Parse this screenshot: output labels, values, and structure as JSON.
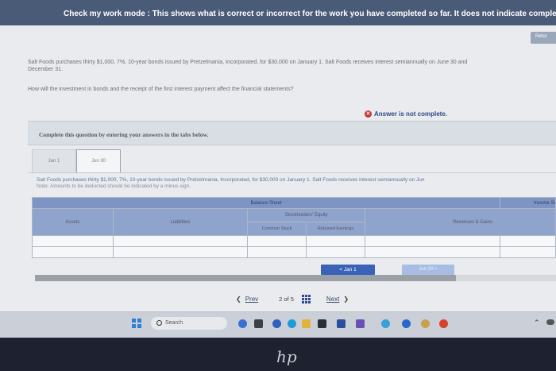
{
  "banner": "Check my work mode : This shows what is correct or incorrect for the work you have completed so far. It does not indicate completion.",
  "return_label": "Retur",
  "question": {
    "text": "Salt Foods purchases thirty $1,000, 7%, 10-year bonds issued by Pretzelmania, Incorporated, for $30,000 on January 1. Salt Foods receives interest semiannually on June 30 and December 31.",
    "prompt": "How will the investment in bonds and the receipt of the first interest payment affect the financial statements?"
  },
  "status": "Answer is not complete.",
  "instructions": "Complete this question by entering your answers in the tabs below.",
  "tabs": [
    {
      "label": "Jan 1"
    },
    {
      "label": "Jun 30"
    }
  ],
  "panel": {
    "note1": "Salt Foods purchases thirty $1,000, 7%, 10-year bonds issued by Pretzelmania, Incorporated, for $30,000 on January 1. Salt Foods receives interest semiannually on Jun",
    "note2": "Note: Amounts to be deducted should be indicated by a minus sign."
  },
  "table": {
    "balance_sheet": "Balance Sheet",
    "income": "Income St",
    "assets": "Assets",
    "liabilities": "Liabilities",
    "equity": "Stockholders' Equity",
    "common": "Common Stock",
    "retained": "Retained Earnings",
    "revenues": "Revenues & Gains"
  },
  "nav": {
    "jan1": "<  Jan 1",
    "jun30": "Jun 30  >"
  },
  "pager": {
    "prev": "Prev",
    "page": "2 of 5",
    "next": "Next"
  },
  "taskbar": {
    "search": "Search"
  },
  "bezel_logo": "hp",
  "colors": {
    "banner": "#4a5b78",
    "table_header": "#7e95c3",
    "accent": "#3a62b6",
    "error": "#c9302c"
  }
}
